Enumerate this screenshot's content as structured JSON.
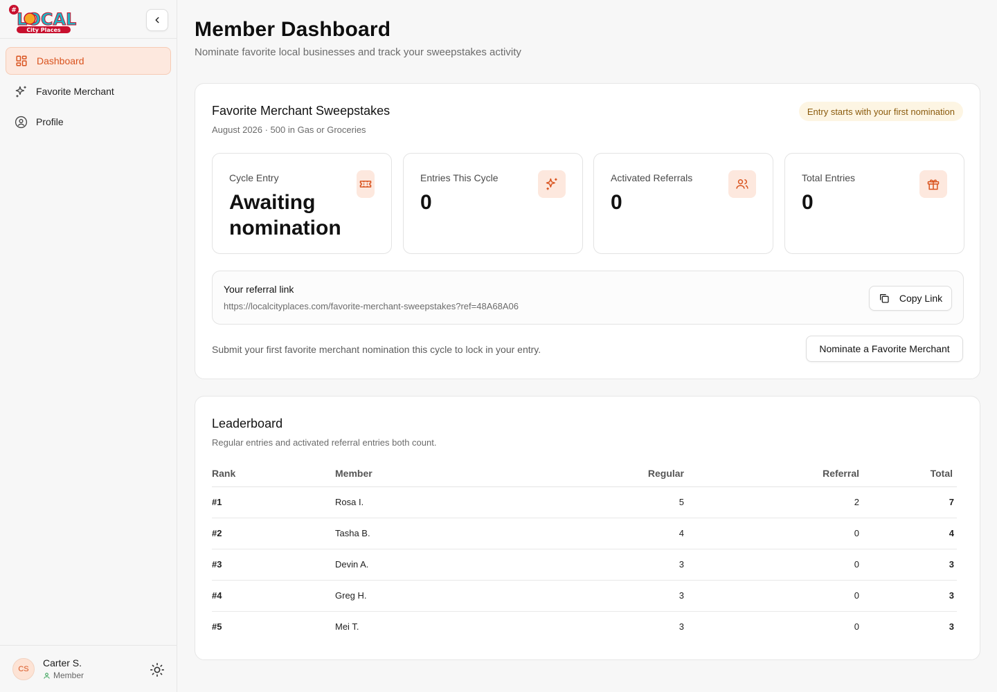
{
  "app": {
    "logo_text_top": "LOCAL",
    "logo_text_bottom": "City Places",
    "colors": {
      "accent": "#d9531e",
      "accent_bg": "#fde8de",
      "badge_bg": "#fdf5e3",
      "badge_text": "#8a5a0c"
    }
  },
  "sidebar": {
    "items": [
      {
        "label": "Dashboard",
        "icon": "layout-dashboard-icon",
        "active": true
      },
      {
        "label": "Favorite Merchant",
        "icon": "sparkles-icon",
        "active": false
      },
      {
        "label": "Profile",
        "icon": "user-circle-icon",
        "active": false
      }
    ],
    "user": {
      "initials": "CS",
      "name": "Carter S.",
      "role": "Member"
    }
  },
  "header": {
    "title": "Member Dashboard",
    "subtitle": "Nominate favorite local businesses and track your sweepstakes activity"
  },
  "sweepstakes": {
    "title": "Favorite Merchant Sweepstakes",
    "subtitle": "August 2026 · 500 in Gas or Groceries",
    "badge": "Entry starts with your first nomination",
    "stats": [
      {
        "label": "Cycle Entry",
        "value": "Awaiting nomination",
        "icon": "ticket-icon"
      },
      {
        "label": "Entries This Cycle",
        "value": "0",
        "icon": "sparkles-icon"
      },
      {
        "label": "Activated Referrals",
        "value": "0",
        "icon": "users-icon"
      },
      {
        "label": "Total Entries",
        "value": "0",
        "icon": "gift-icon"
      }
    ],
    "referral": {
      "label": "Your referral link",
      "url": "https://localcityplaces.com/favorite-merchant-sweepstakes?ref=48A68A06",
      "copy_label": "Copy Link"
    },
    "nominate_text": "Submit your first favorite merchant nomination this cycle to lock in your entry.",
    "nominate_button": "Nominate a Favorite Merchant"
  },
  "leaderboard": {
    "title": "Leaderboard",
    "subtitle": "Regular entries and activated referral entries both count.",
    "columns": [
      "Rank",
      "Member",
      "Regular",
      "Referral",
      "Total"
    ],
    "rows": [
      {
        "rank": "#1",
        "member": "Rosa I.",
        "regular": "5",
        "referral": "2",
        "total": "7"
      },
      {
        "rank": "#2",
        "member": "Tasha B.",
        "regular": "4",
        "referral": "0",
        "total": "4"
      },
      {
        "rank": "#3",
        "member": "Devin A.",
        "regular": "3",
        "referral": "0",
        "total": "3"
      },
      {
        "rank": "#4",
        "member": "Greg H.",
        "regular": "3",
        "referral": "0",
        "total": "3"
      },
      {
        "rank": "#5",
        "member": "Mei T.",
        "regular": "3",
        "referral": "0",
        "total": "3"
      }
    ]
  }
}
